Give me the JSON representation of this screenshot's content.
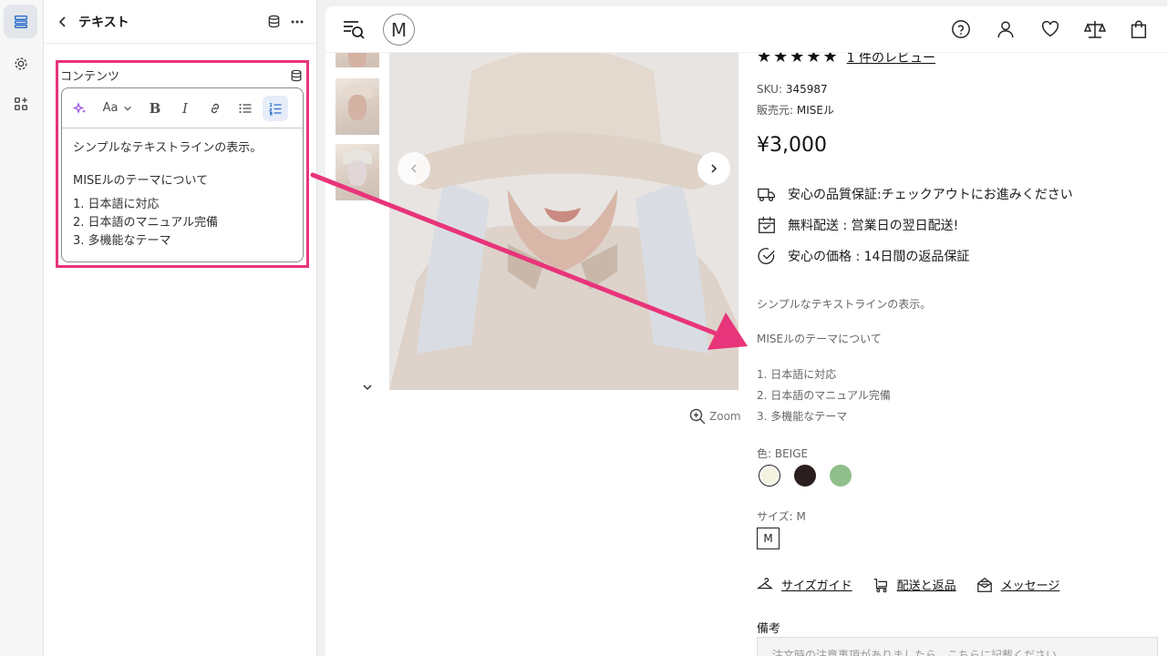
{
  "panel": {
    "title": "テキスト",
    "field_label": "コンテンツ",
    "toolbar": {
      "font_label": "Aa"
    },
    "editor": {
      "paragraph1": "シンプルなテキストラインの表示。",
      "paragraph2": "MISEルのテーマについて",
      "list": [
        "1. 日本語に対応",
        "2. 日本語のマニュアル完備",
        "3. 多機能なテーマ"
      ]
    }
  },
  "store": {
    "logo": "M",
    "zoom_label": "Zoom",
    "review_link": "1 件のレビュー",
    "sku_label": "SKU:",
    "sku_value": "345987",
    "vendor_label": "販売元:",
    "vendor_value": "MISEル",
    "price": "¥3,000",
    "features": [
      "安心の品質保証:チェックアウトにお進みください",
      "無料配送 : 営業日の翌日配送!",
      "安心の価格 : 14日間の返品保証"
    ],
    "description": {
      "line1": "シンプルなテキストラインの表示。",
      "line2": "MISEルのテーマについて",
      "list": [
        "1. 日本語に対応",
        "2. 日本語のマニュアル完備",
        "3. 多機能なテーマ"
      ]
    },
    "color_label": "色: BEIGE",
    "colors": [
      "#f4f2e1",
      "#2b1e1e",
      "#8fbf8a"
    ],
    "size_label": "サイズ: M",
    "size_value": "M",
    "links": [
      "サイズガイド",
      "配送と返品",
      "メッセージ"
    ],
    "note_label": "備考",
    "note_placeholder": "注文時の注意事項がありましたら、こちらに記載ください。"
  },
  "colors": {
    "highlight": "#e8347a",
    "ai_icon": "#9b51e0",
    "active_list": "#2c6ecb"
  }
}
